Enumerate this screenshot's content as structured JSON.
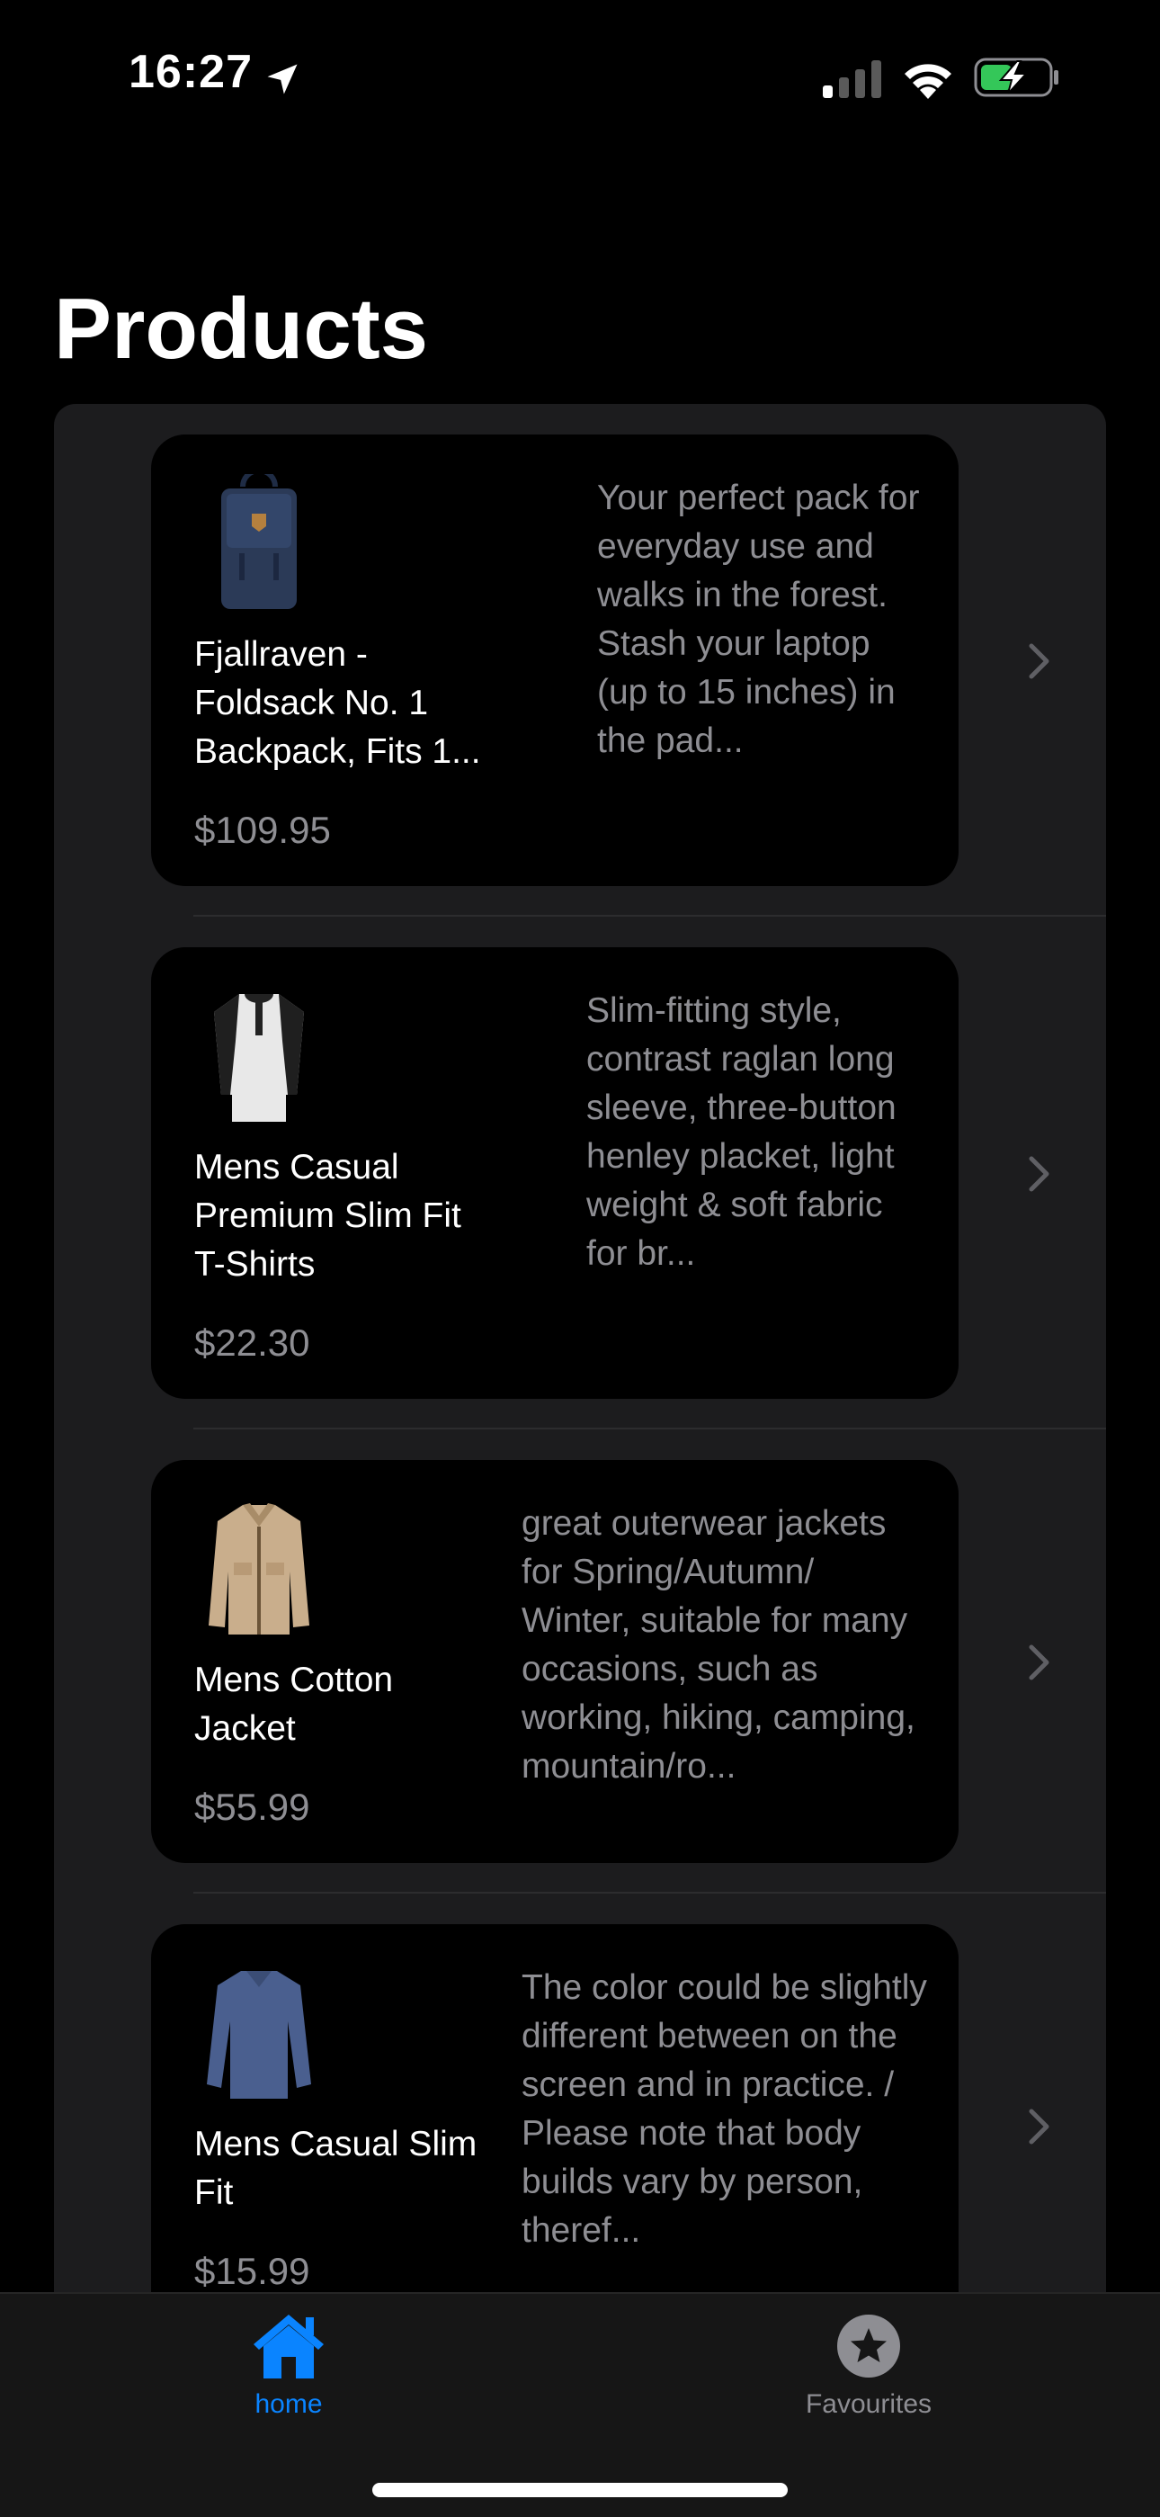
{
  "status_bar": {
    "time": "16:27"
  },
  "title": "Products",
  "products": [
    {
      "name": "Fjallraven - Foldsack No. 1 Backpack, Fits 1...",
      "price": "$109.95",
      "description": "Your perfect pack for everyday use and walks in the forest. Stash your laptop (up to 15 inches) in the pad...",
      "image_icon": "backpack-icon",
      "image_color": "#2b3a57"
    },
    {
      "name": "Mens Casual Premium Slim Fit T-Shirts",
      "price": "$22.30",
      "description": "Slim-fitting style, contrast raglan long sleeve, three-button henley placket, light weight & soft fabric for br...",
      "image_icon": "tshirt-icon",
      "image_color": "#e8e8e8"
    },
    {
      "name": "Mens Cotton Jacket",
      "price": "$55.99",
      "description": "great outerwear jackets for Spring/Autumn/ Winter, suitable for many occasions, such as working, hiking, camping, mountain/ro...",
      "image_icon": "jacket-icon",
      "image_color": "#c9ae8c"
    },
    {
      "name": "Mens Casual Slim Fit",
      "price": "$15.99",
      "description": "The color could be slightly different between on the screen and in practice. / Please note that body builds vary by person, theref...",
      "image_icon": "longsleeve-icon",
      "image_color": "#4a5f8f"
    }
  ],
  "tabs": [
    {
      "label": "home",
      "icon": "house-icon",
      "selected": true
    },
    {
      "label": "Favourites",
      "icon": "star-icon",
      "selected": false
    }
  ],
  "colors": {
    "accent": "#0a84ff",
    "secondary_text": "#8e8e93",
    "battery": "#34c759"
  }
}
